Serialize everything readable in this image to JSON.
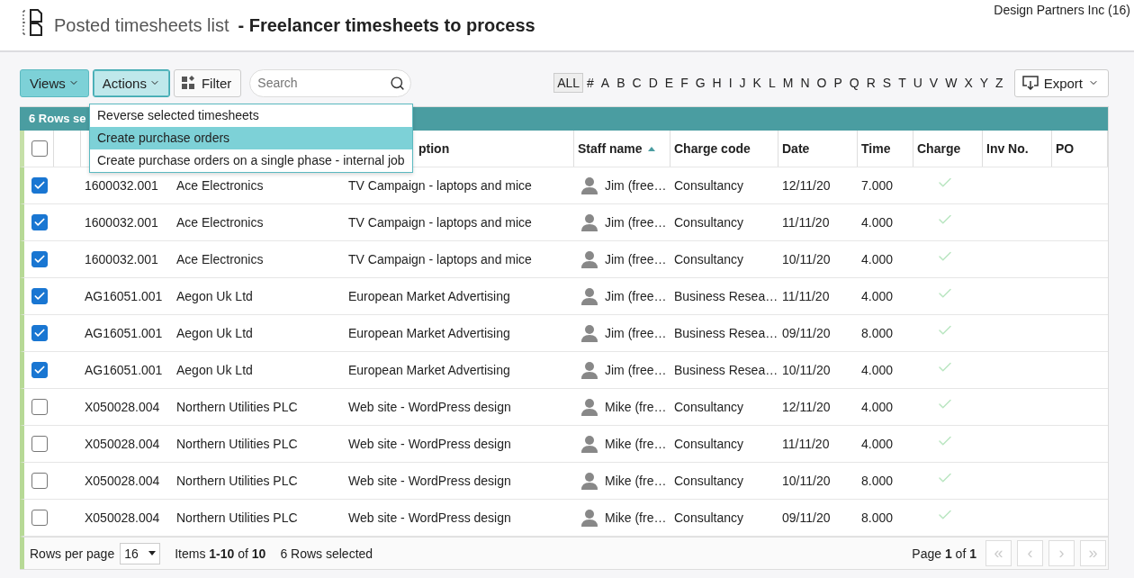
{
  "page": {
    "title": "Posted timesheets list",
    "subtitle": "- Freelancer timesheets to process",
    "company": "Design Partners Inc (16)"
  },
  "toolbar": {
    "views": "Views",
    "actions": "Actions",
    "filter": "Filter",
    "search": {
      "placeholder": "Search"
    },
    "export": "Export"
  },
  "alphabet": [
    {
      "label": "ALL",
      "selected": true
    },
    {
      "label": "#",
      "selected": false
    },
    {
      "label": "A",
      "selected": false
    },
    {
      "label": "B",
      "selected": false
    },
    {
      "label": "C",
      "selected": false
    },
    {
      "label": "D",
      "selected": false
    },
    {
      "label": "E",
      "selected": false
    },
    {
      "label": "F",
      "selected": false
    },
    {
      "label": "G",
      "selected": false
    },
    {
      "label": "H",
      "selected": false
    },
    {
      "label": "I",
      "selected": false
    },
    {
      "label": "J",
      "selected": false
    },
    {
      "label": "K",
      "selected": false
    },
    {
      "label": "L",
      "selected": false
    },
    {
      "label": "M",
      "selected": false
    },
    {
      "label": "N",
      "selected": false
    },
    {
      "label": "O",
      "selected": false
    },
    {
      "label": "P",
      "selected": false
    },
    {
      "label": "Q",
      "selected": false
    },
    {
      "label": "R",
      "selected": false
    },
    {
      "label": "S",
      "selected": false
    },
    {
      "label": "T",
      "selected": false
    },
    {
      "label": "U",
      "selected": false
    },
    {
      "label": "V",
      "selected": false
    },
    {
      "label": "W",
      "selected": false
    },
    {
      "label": "X",
      "selected": false
    },
    {
      "label": "Y",
      "selected": false
    },
    {
      "label": "Z",
      "selected": false
    }
  ],
  "actions_menu": [
    {
      "label": "Reverse selected timesheets",
      "selected": false
    },
    {
      "label": "Create purchase orders",
      "selected": true
    },
    {
      "label": "Create purchase orders on a single phase - internal job",
      "selected": false
    }
  ],
  "table": {
    "banner": "6 Rows se",
    "all_checked": false,
    "columns": [
      {
        "label": "ption",
        "sorted": false
      },
      {
        "label": "Staff name",
        "sorted": true
      },
      {
        "label": "Charge code",
        "sorted": false
      },
      {
        "label": "Date",
        "sorted": false
      },
      {
        "label": "Time",
        "sorted": false
      },
      {
        "label": "Charge",
        "sorted": false
      },
      {
        "label": "Inv No.",
        "sorted": false
      },
      {
        "label": "PO",
        "sorted": false
      }
    ],
    "rows": [
      {
        "selected": true,
        "job": "1600032.001",
        "client": "Ace Electronics",
        "description": "TV Campaign - laptops and mice",
        "staff": "Jim (free…",
        "charge_code": "Consultancy",
        "date": "12/11/20",
        "time": "7.000",
        "charge": true
      },
      {
        "selected": true,
        "job": "1600032.001",
        "client": "Ace Electronics",
        "description": "TV Campaign - laptops and mice",
        "staff": "Jim (free…",
        "charge_code": "Consultancy",
        "date": "11/11/20",
        "time": "4.000",
        "charge": true
      },
      {
        "selected": true,
        "job": "1600032.001",
        "client": "Ace Electronics",
        "description": "TV Campaign - laptops and mice",
        "staff": "Jim (free…",
        "charge_code": "Consultancy",
        "date": "10/11/20",
        "time": "4.000",
        "charge": true
      },
      {
        "selected": true,
        "job": "AG16051.001",
        "client": "Aegon Uk Ltd",
        "description": "European Market Advertising",
        "staff": "Jim (free…",
        "charge_code": "Business Resea…",
        "date": "11/11/20",
        "time": "4.000",
        "charge": true
      },
      {
        "selected": true,
        "job": "AG16051.001",
        "client": "Aegon Uk Ltd",
        "description": "European Market Advertising",
        "staff": "Jim (free…",
        "charge_code": "Business Resea…",
        "date": "09/11/20",
        "time": "8.000",
        "charge": true
      },
      {
        "selected": true,
        "job": "AG16051.001",
        "client": "Aegon Uk Ltd",
        "description": "European Market Advertising",
        "staff": "Jim (free…",
        "charge_code": "Business Resea…",
        "date": "10/11/20",
        "time": "4.000",
        "charge": true
      },
      {
        "selected": false,
        "job": "X050028.004",
        "client": "Northern Utilities PLC",
        "description": "Web site - WordPress design",
        "staff": "Mike (fre…",
        "charge_code": "Consultancy",
        "date": "12/11/20",
        "time": "4.000",
        "charge": true
      },
      {
        "selected": false,
        "job": "X050028.004",
        "client": "Northern Utilities PLC",
        "description": "Web site - WordPress design",
        "staff": "Mike (fre…",
        "charge_code": "Consultancy",
        "date": "11/11/20",
        "time": "4.000",
        "charge": true
      },
      {
        "selected": false,
        "job": "X050028.004",
        "client": "Northern Utilities PLC",
        "description": "Web site - WordPress design",
        "staff": "Mike (fre…",
        "charge_code": "Consultancy",
        "date": "10/11/20",
        "time": "8.000",
        "charge": true
      },
      {
        "selected": false,
        "job": "X050028.004",
        "client": "Northern Utilities PLC",
        "description": "Web site - WordPress design",
        "staff": "Mike (fre…",
        "charge_code": "Consultancy",
        "date": "09/11/20",
        "time": "8.000",
        "charge": true
      }
    ]
  },
  "footer": {
    "rows_per_page_label": "Rows per page",
    "rows_per_page": "16",
    "items": "Items **1-10** of **10**",
    "selected": "6 Rows selected",
    "page": "Page **1** of **1**",
    "pager": [
      {
        "label": "«",
        "disabled": true
      },
      {
        "label": "‹",
        "disabled": true
      },
      {
        "label": "›",
        "disabled": true
      },
      {
        "label": "»",
        "disabled": true
      }
    ]
  }
}
